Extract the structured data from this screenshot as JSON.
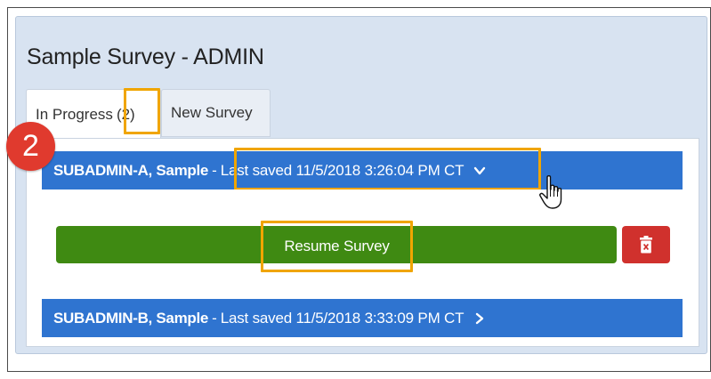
{
  "page": {
    "title": "Sample Survey - ADMIN"
  },
  "tabs": {
    "in_progress_label": "In Progress",
    "in_progress_count": "(2)",
    "new_survey_label": "New Survey"
  },
  "callout": {
    "step_number": "2"
  },
  "entries": [
    {
      "name": "SUBADMIN-A, Sample",
      "separator": "-",
      "saved": "Last saved 11/5/2018 3:26:04 PM CT",
      "expanded": true,
      "chevron": "chevron-down-icon"
    },
    {
      "name": "SUBADMIN-B, Sample",
      "separator": "-",
      "saved": "Last saved 11/5/2018 3:33:09 PM CT",
      "expanded": false,
      "chevron": "chevron-right-icon"
    }
  ],
  "actions": {
    "resume_label": "Resume Survey",
    "delete_icon": "trash-icon"
  },
  "colors": {
    "panel_bg": "#d8e3f1",
    "entry_bar": "#2f74d0",
    "resume_green": "#3f8a12",
    "delete_red": "#d0312d",
    "highlight_orange": "#f0a500",
    "badge_red": "#e03a2e"
  }
}
